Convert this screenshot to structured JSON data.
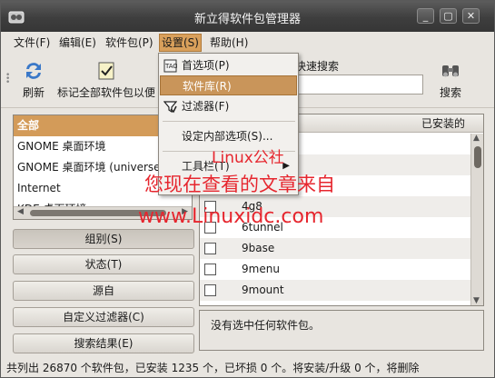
{
  "window": {
    "title": "新立得软件包管理器",
    "controls": [
      "_",
      "▢",
      "✕"
    ]
  },
  "menubar": {
    "file": "文件(F)",
    "edit": "编辑(E)",
    "package": "软件包(P)",
    "settings": "设置(S)",
    "help": "帮助(H)"
  },
  "toolbar": {
    "refresh": "刷新",
    "mark_all": "标记全部软件包以便",
    "search_label": "快速搜索",
    "search_value": "",
    "search_button": "搜索"
  },
  "settings_menu": {
    "items": [
      "首选项(P)",
      "软件库(R)",
      "过滤器(F)",
      "设定内部选项(S)...",
      "工具栏(T)"
    ]
  },
  "sections": {
    "items": [
      "全部",
      "GNOME 桌面环境",
      "GNOME 桌面环境 (universe)",
      "Internet",
      "KDE 桌面环境"
    ]
  },
  "filter_buttons": {
    "sections": "组别(S)",
    "status": "状态(T)",
    "origin": "源自",
    "custom": "自定义过滤器(C)",
    "search_results": "搜索结果(E)"
  },
  "package_table": {
    "col_installed": "已安装的",
    "packages": [
      "",
      "",
      "",
      "4g8",
      "6tunnel",
      "9base",
      "9menu",
      "9mount"
    ]
  },
  "description": {
    "text": "没有选中任何软件包。"
  },
  "statusbar": {
    "text": "共列出 26870 个软件包，已安装 1235 个，已坏损 0 个。将安装/升级 0 个，将删除"
  },
  "watermark": {
    "line1": "Linux公社",
    "line2": "您现在查看的文章来自",
    "line3": "www.Linuxidc.com"
  },
  "colors": {
    "accent": "#d39b59",
    "watermark": "#e6262e"
  }
}
